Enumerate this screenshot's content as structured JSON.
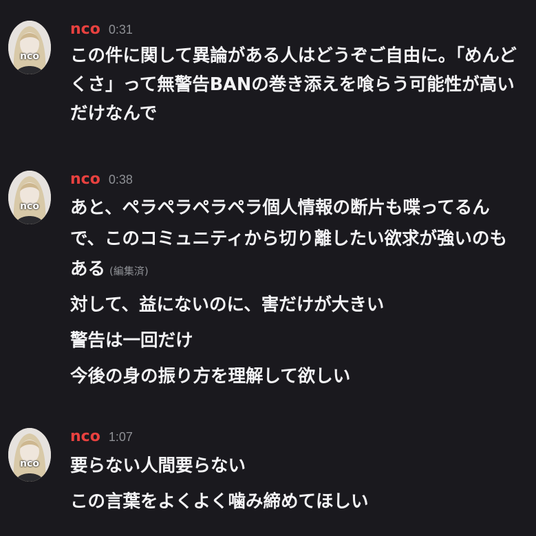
{
  "colors": {
    "background": "#1a191e",
    "username": "#e8413f",
    "timestamp": "#8e9095",
    "message_text": "#f3f3f5"
  },
  "messages": [
    {
      "author": "nco",
      "avatar_label": "nco",
      "time": "0:31",
      "lines": [
        "この件に関して異論がある人はどうぞご自由に。「めんど",
        "くさ」って無警告BANの巻き添えを喰らう可能性が高い",
        "だけなんで"
      ]
    },
    {
      "author": "nco",
      "avatar_label": "nco",
      "time": "0:38",
      "lines": [
        "あと、ペラペラペラペラ個人情報の断片も喋ってるん",
        "で、このコミュニティから切り離したい欲求が強いのも",
        "ある"
      ],
      "edited_label": "(編集済)",
      "followups": [
        "対して、益にないのに、害だけが大きい",
        "警告は一回だけ",
        "今後の身の振り方を理解して欲しい"
      ]
    },
    {
      "author": "nco",
      "avatar_label": "nco",
      "time": "1:07",
      "lines": [
        "要らない人間要らない",
        "この言葉をよくよく噛み締めてほしい"
      ]
    }
  ]
}
